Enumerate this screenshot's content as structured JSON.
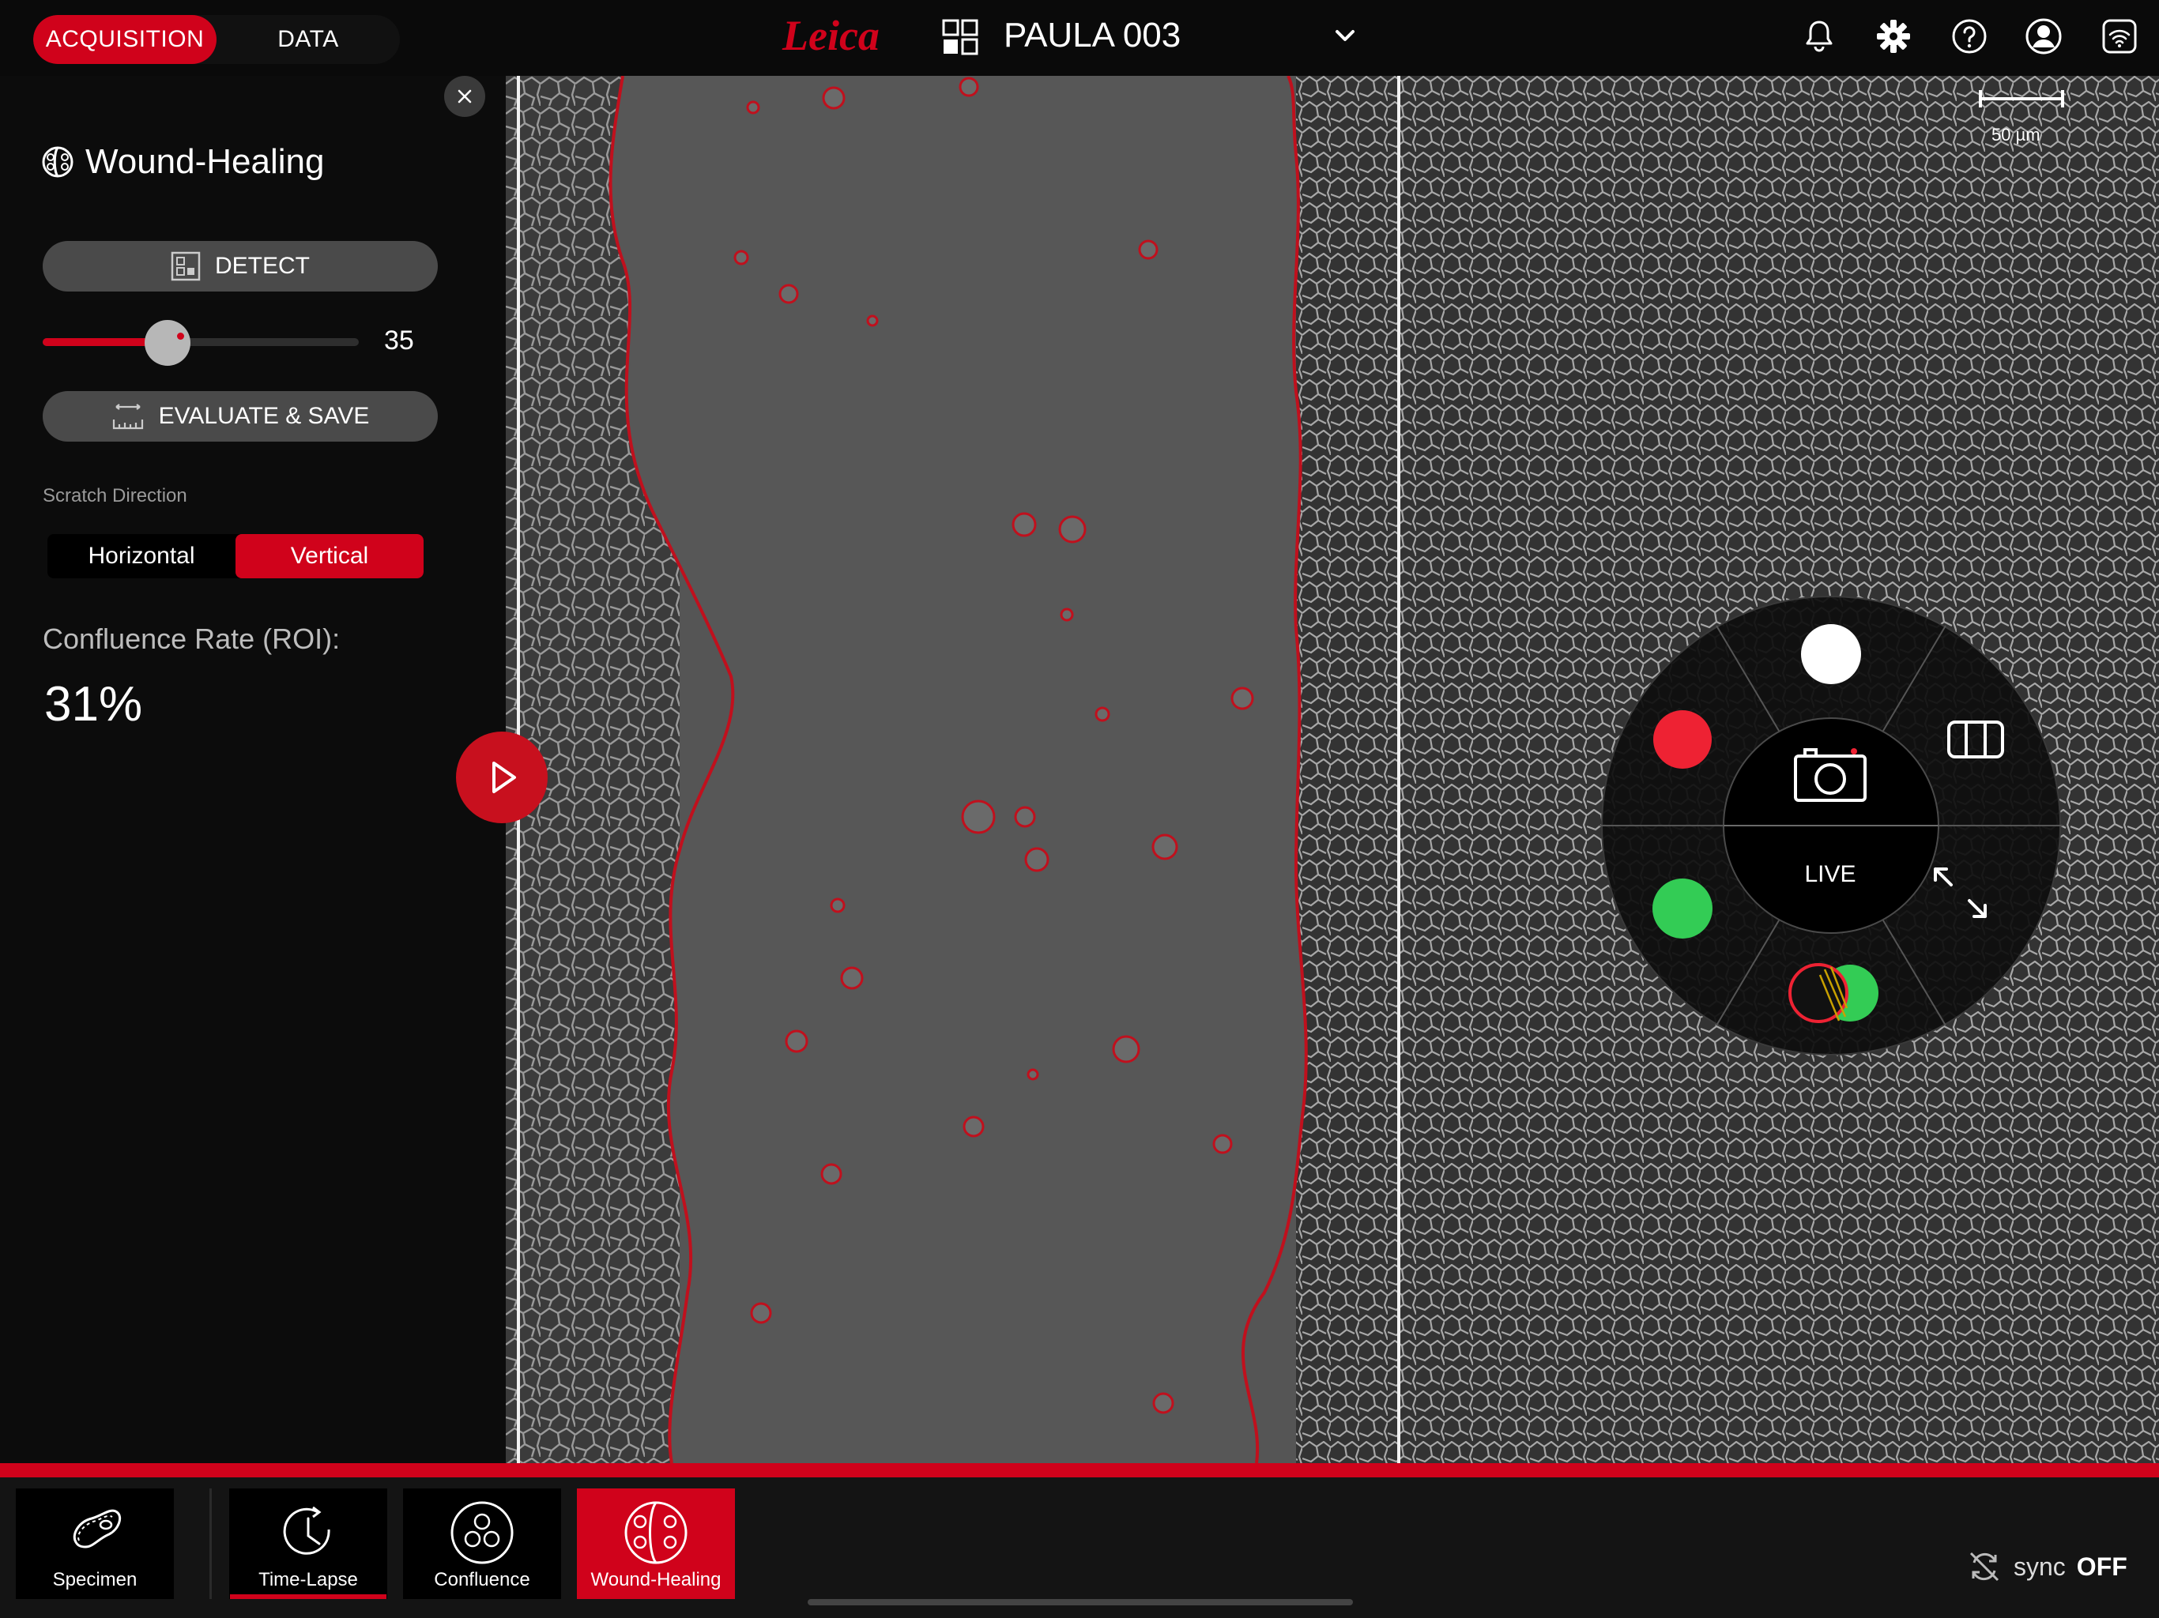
{
  "header": {
    "mode_tabs": [
      "ACQUISITION",
      "DATA"
    ],
    "active_mode": "ACQUISITION",
    "brand": "Leica",
    "experiment_title": "PAULA 003",
    "icons": [
      "bell-icon",
      "gear-icon",
      "help-icon",
      "user-icon",
      "wifi-icon"
    ]
  },
  "panel": {
    "app_title": "Wound-Healing",
    "detect_label": "DETECT",
    "slider_value": 35,
    "slider_fraction": 0.35,
    "evaluate_label": "EVALUATE & SAVE",
    "scratch_direction_label": "Scratch Direction",
    "directions": [
      "Horizontal",
      "Vertical"
    ],
    "selected_direction": "Vertical",
    "confluence_label": "Confluence Rate (ROI):",
    "confluence_value": "31%"
  },
  "viewer": {
    "scale_bar_label": "50 µm",
    "live_label": "LIVE"
  },
  "bottom_tabs": [
    {
      "label": "Specimen",
      "icon": "specimen-icon"
    },
    {
      "label": "Time-Lapse",
      "icon": "clock-icon"
    },
    {
      "label": "Confluence",
      "icon": "cells-icon"
    },
    {
      "label": "Wound-Healing",
      "icon": "wound-icon"
    }
  ],
  "active_tab": "Wound-Healing",
  "sync": {
    "label": "sync",
    "state": "OFF"
  },
  "colors": {
    "accent": "#d0021b",
    "green": "#33cc55",
    "panel": "#0c0c0c"
  }
}
